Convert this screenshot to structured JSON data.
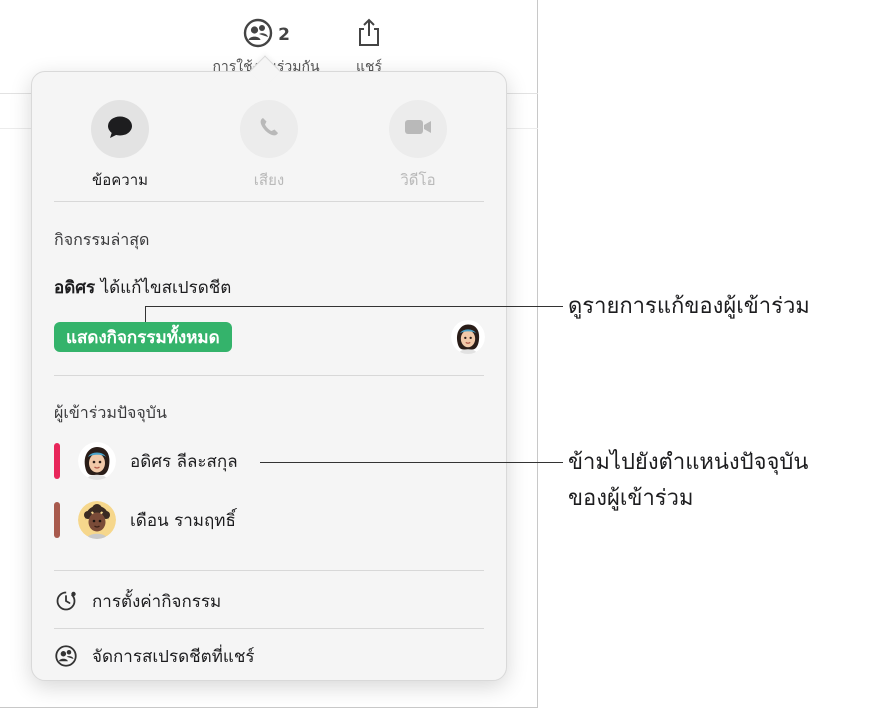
{
  "toolbar": {
    "collab_count": "2",
    "collab_label": "การใช้งานร่วมกัน",
    "share_label": "แชร์"
  },
  "popover": {
    "comm": {
      "message_label": "ข้อความ",
      "audio_label": "เสียง",
      "video_label": "วิดีโอ"
    },
    "recent_activity_title": "กิจกรรมล่าสุด",
    "activity": {
      "who": "อดิศร",
      "what": " ได้แก้ไขสเปรดชีต"
    },
    "show_all_label": "แสดงกิจกรรมทั้งหมด",
    "participants_title": "ผู้เข้าร่วมปัจจุบัน",
    "participants": [
      {
        "name": "อดิศร ลีละสกุล",
        "color": "#e8265a"
      },
      {
        "name": "เดือน รามฤทธิ์",
        "color": "#a85a4d"
      }
    ],
    "menu": {
      "activity_settings": "การตั้งค่ากิจกรรม",
      "manage_shared": "จัดการสเปรดชีตที่แชร์"
    }
  },
  "callouts": {
    "view_edits": "ดูรายการแก้ของผู้เข้าร่วม",
    "jump_line1": "ข้ามไปยังตำแหน่งปัจจุบัน",
    "jump_line2": "ของผู้เข้าร่วม"
  },
  "colors": {
    "accent_green": "#34b36b",
    "participant_1": "#e8265a",
    "participant_2": "#a85a4d"
  }
}
